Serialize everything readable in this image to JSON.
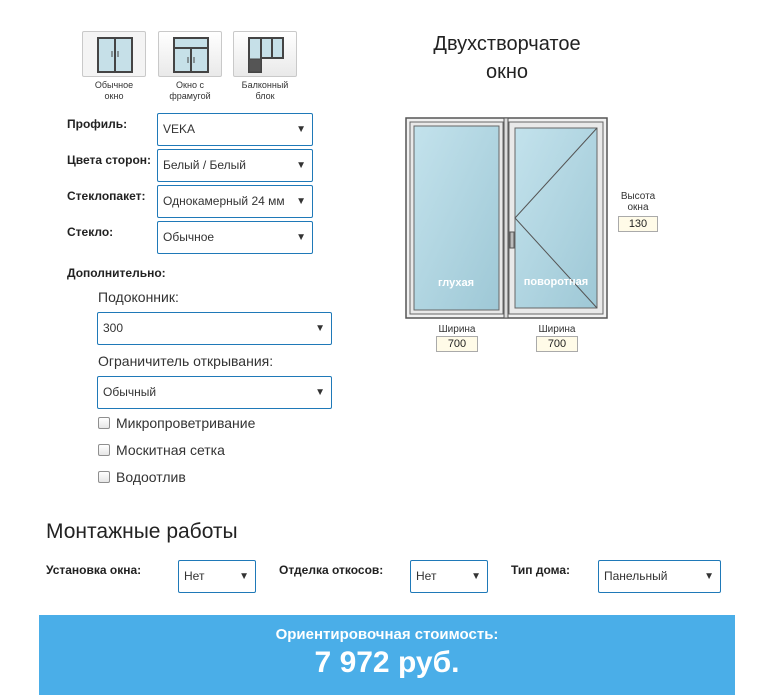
{
  "window_types": [
    {
      "label_line1": "Обычное",
      "label_line2": "окно",
      "icon": "double-window-icon"
    },
    {
      "label_line1": "Окно с",
      "label_line2": "фрамугой",
      "icon": "transom-window-icon"
    },
    {
      "label_line1": "Балконный",
      "label_line2": "блок",
      "icon": "balcony-block-icon"
    }
  ],
  "options": {
    "profile": {
      "label": "Профиль:",
      "value": "VEKA"
    },
    "colors": {
      "label": "Цвета сторон:",
      "value": "Белый / Белый"
    },
    "glass_unit": {
      "label": "Стеклопакет:",
      "value": "Однокамерный 24 мм"
    },
    "glass": {
      "label": "Стекло:",
      "value": "Обычное"
    }
  },
  "additional": {
    "label": "Дополнительно:",
    "sill": {
      "label": "Подоконник:",
      "value": "300"
    },
    "limiter": {
      "label": "Ограничитель открывания:",
      "value": "Обычный"
    },
    "checkboxes": [
      "Микропроветривание",
      "Москитная сетка",
      "Водоотлив"
    ]
  },
  "preview": {
    "title_line1": "Двухстворчатое",
    "title_line2": "окно",
    "left_sash": "глухая",
    "right_sash": "поворотная",
    "height_label_line1": "Высота",
    "height_label_line2": "окна",
    "height_value": "130",
    "width_label": "Ширина",
    "width_left_value": "700",
    "width_right_value": "700"
  },
  "installation": {
    "title": "Монтажные работы",
    "install": {
      "label": "Установка окна:",
      "value": "Нет"
    },
    "slopes": {
      "label": "Отделка откосов:",
      "value": "Нет"
    },
    "house": {
      "label": "Тип дома:",
      "value": "Панельный"
    }
  },
  "cost": {
    "label": "Ориентировочная стоимость:",
    "value": "7 972 руб."
  },
  "colors": {
    "accent": "#4aaee8",
    "select_border": "#1f79b8",
    "glass": "#b8dbe6"
  }
}
